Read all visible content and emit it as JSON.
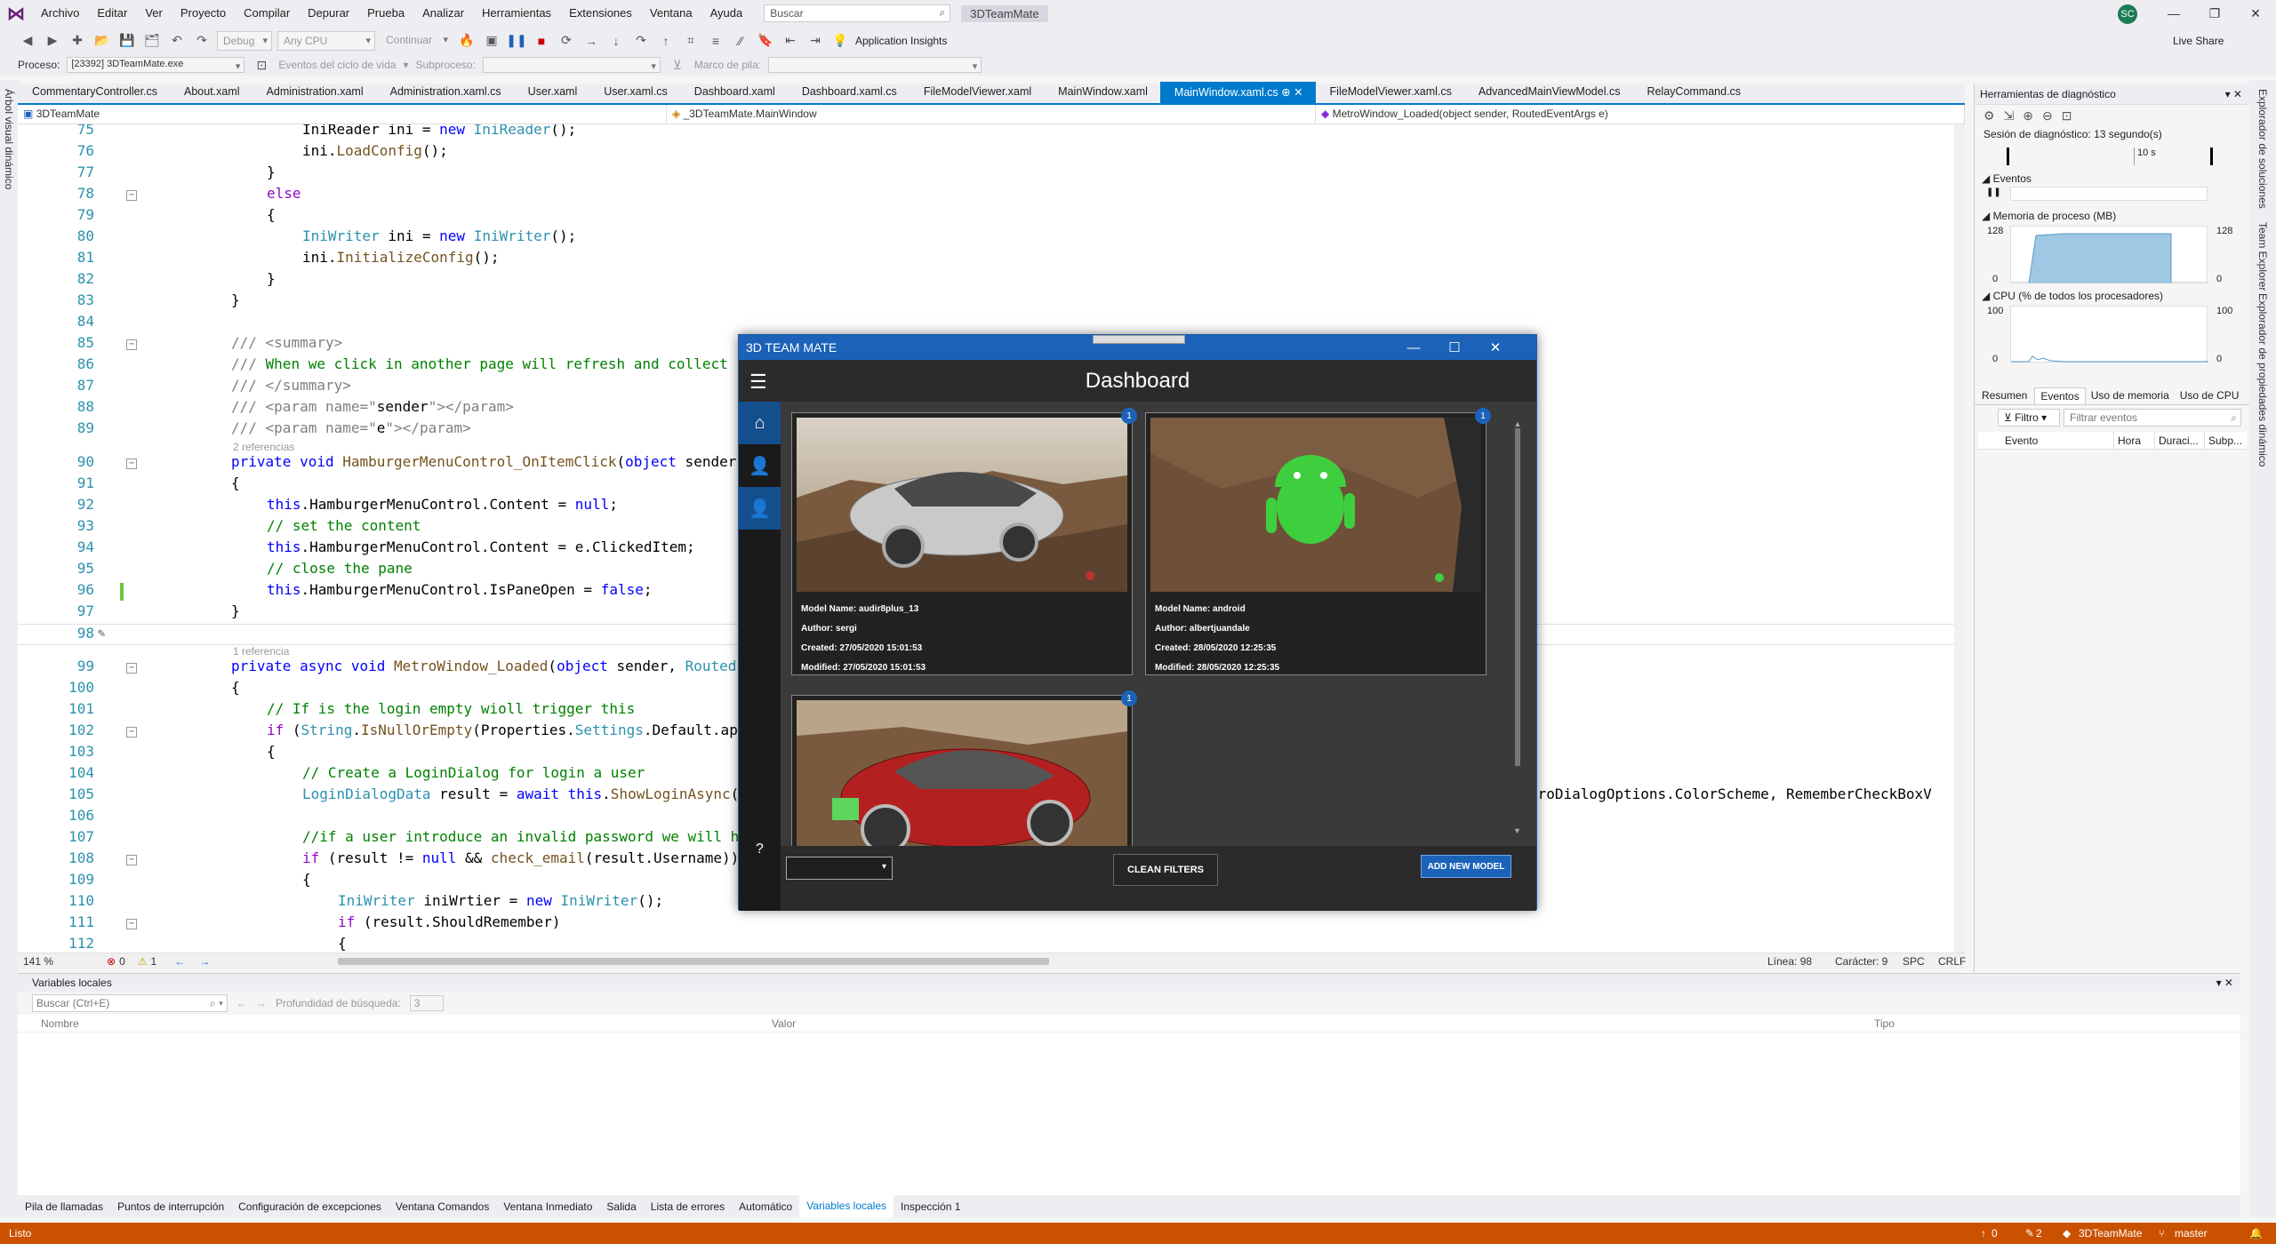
{
  "titlebar": {
    "menu": [
      "Archivo",
      "Editar",
      "Ver",
      "Proyecto",
      "Compilar",
      "Depurar",
      "Prueba",
      "Analizar",
      "Herramientas",
      "Extensiones",
      "Ventana",
      "Ayuda"
    ],
    "search_placeholder": "Buscar",
    "project": "3DTeamMate",
    "avatar": "SC",
    "live_share": "Live Share"
  },
  "toolbar": {
    "config": "Debug",
    "platform": "Any CPU",
    "continue": "Continuar",
    "insights": "Application Insights",
    "process_label": "Proceso:",
    "process_value": "[23392] 3DTeamMate.exe",
    "lifecycle": "Eventos del ciclo de vida",
    "thread_label": "Subproceso:",
    "stack_label": "Marco de pila:"
  },
  "leftrail": "Árbol visual dinámico",
  "tabs": [
    "CommentaryController.cs",
    "About.xaml",
    "Administration.xaml",
    "Administration.xaml.cs",
    "User.xaml",
    "User.xaml.cs",
    "Dashboard.xaml",
    "Dashboard.xaml.cs",
    "FileModelViewer.xaml",
    "MainWindow.xaml",
    "MainWindow.xaml.cs",
    "FileModelViewer.xaml.cs",
    "AdvancedMainViewModel.cs",
    "RelayCommand.cs"
  ],
  "navbar": {
    "project": "3DTeamMate",
    "class": "_3DTeamMate.MainWindow",
    "member": "MetroWindow_Loaded(object sender, RoutedEventArgs e)"
  },
  "code": {
    "ref2": "2 referencias",
    "ref1": "1 referencia",
    "overflow": "troDialogOptions.ColorScheme, RememberCheckBoxV"
  },
  "editor_status": {
    "zoom": "141 %",
    "errors": "0",
    "warnings": "1",
    "line": "Línea: 98",
    "col": "Carácter: 9",
    "spc": "SPC",
    "crlf": "CRLF"
  },
  "diag": {
    "title": "Herramientas de diagnóstico",
    "session": "Sesión de diagnóstico: 13 segundo(s)",
    "tick": "10 s",
    "events": "Eventos",
    "memory": "Memoria de proceso (MB)",
    "mem_max": "128",
    "mem_min": "0",
    "cpu": "CPU (% de todos los procesadores)",
    "cpu_max": "100",
    "cpu_min": "0",
    "tabs": [
      "Resumen",
      "Eventos",
      "Uso de memoria",
      "Uso de CPU"
    ],
    "filter": "Filtro",
    "filter_placeholder": "Filtrar eventos",
    "cols": [
      "Evento",
      "Hora",
      "Duraci...",
      "Subp..."
    ]
  },
  "rightrail": [
    "Explorador de soluciones",
    "Team Explorer",
    "Explorador de propiedades dinámico"
  ],
  "bottom": {
    "title": "Variables locales",
    "search": "Buscar (Ctrl+E)",
    "depth": "Profundidad de búsqueda:",
    "depth_val": "3",
    "cols": [
      "Nombre",
      "Valor",
      "Tipo"
    ],
    "tabs": [
      "Pila de llamadas",
      "Puntos de interrupción",
      "Configuración de excepciones",
      "Ventana Comandos",
      "Ventana Inmediato",
      "Salida",
      "Lista de errores",
      "Automático",
      "Variables locales",
      "Inspección 1"
    ]
  },
  "status": {
    "ready": "Listo",
    "up": "0",
    "edits": "2",
    "repo": "3DTeamMate",
    "branch": "master"
  },
  "app": {
    "title": "3D TEAM MATE",
    "header": "Dashboard",
    "cards": [
      {
        "name": "Model Name: audir8plus_13",
        "author": "Author: sergi",
        "created": "Created: 27/05/2020 15:01:53",
        "modified": "Modified: 27/05/2020 15:01:53",
        "badge": "1"
      },
      {
        "name": "Model Name: android",
        "author": "Author: albertjuandale",
        "created": "Created: 28/05/2020 12:25:35",
        "modified": "Modified: 28/05/2020 12:25:35",
        "badge": "1"
      },
      {
        "name": "",
        "author": "",
        "created": "",
        "modified": "",
        "badge": "1"
      }
    ],
    "help": "?",
    "clean": "CLEAN FILTERS",
    "add": "ADD NEW MODEL"
  }
}
